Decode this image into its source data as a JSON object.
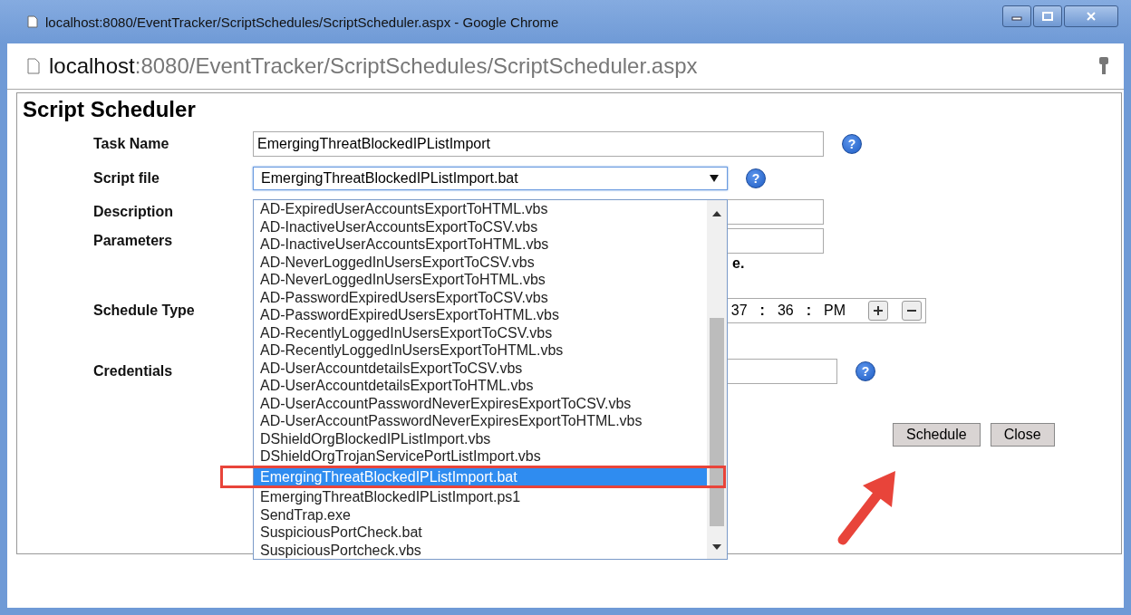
{
  "window": {
    "title": "localhost:8080/EventTracker/ScriptSchedules/ScriptScheduler.aspx - Google Chrome"
  },
  "address_bar": {
    "host": "localhost",
    "path": ":8080/EventTracker/ScriptSchedules/ScriptScheduler.aspx"
  },
  "page": {
    "heading": "Script Scheduler"
  },
  "form": {
    "task_name": {
      "label": "Task Name",
      "value": "EmergingThreatBlockedIPListImport",
      "help": "?"
    },
    "script_file": {
      "label": "Script file",
      "value": "EmergingThreatBlockedIPListImport.bat",
      "help": "?",
      "expanded": true,
      "options": [
        {
          "label": "AD-ExpiredUserAccountsExportToHTML.vbs",
          "selected": false
        },
        {
          "label": "AD-InactiveUserAccountsExportToCSV.vbs",
          "selected": false
        },
        {
          "label": "AD-InactiveUserAccountsExportToHTML.vbs",
          "selected": false
        },
        {
          "label": "AD-NeverLoggedInUsersExportToCSV.vbs",
          "selected": false
        },
        {
          "label": "AD-NeverLoggedInUsersExportToHTML.vbs",
          "selected": false
        },
        {
          "label": "AD-PasswordExpiredUsersExportToCSV.vbs",
          "selected": false
        },
        {
          "label": "AD-PasswordExpiredUsersExportToHTML.vbs",
          "selected": false
        },
        {
          "label": "AD-RecentlyLoggedInUsersExportToCSV.vbs",
          "selected": false
        },
        {
          "label": "AD-RecentlyLoggedInUsersExportToHTML.vbs",
          "selected": false
        },
        {
          "label": "AD-UserAccountdetailsExportToCSV.vbs",
          "selected": false
        },
        {
          "label": "AD-UserAccountdetailsExportToHTML.vbs",
          "selected": false
        },
        {
          "label": "AD-UserAccountPasswordNeverExpiresExportToCSV.vbs",
          "selected": false
        },
        {
          "label": "AD-UserAccountPasswordNeverExpiresExportToHTML.vbs",
          "selected": false
        },
        {
          "label": "DShieldOrgBlockedIPListImport.vbs",
          "selected": false
        },
        {
          "label": "DShieldOrgTrojanServicePortListImport.vbs",
          "selected": false
        },
        {
          "label": "EmergingThreatBlockedIPListImport.bat",
          "selected": true
        },
        {
          "label": "EmergingThreatBlockedIPListImport.ps1",
          "selected": false
        },
        {
          "label": "SendTrap.exe",
          "selected": false
        },
        {
          "label": "SuspiciousPortCheck.bat",
          "selected": false
        },
        {
          "label": "SuspiciousPortcheck.vbs",
          "selected": false
        }
      ]
    },
    "description": {
      "label": "Description"
    },
    "parameters": {
      "label": "Parameters",
      "note": "e."
    },
    "schedule_type": {
      "label": "Schedule Type",
      "time": {
        "minute": "37",
        "separator_1": ":",
        "second": "36",
        "separator_2": ":",
        "ampm": "PM"
      }
    },
    "credentials": {
      "label": "Credentials",
      "help": "?"
    }
  },
  "buttons": [
    {
      "label": "Schedule"
    },
    {
      "label": "Close"
    }
  ]
}
